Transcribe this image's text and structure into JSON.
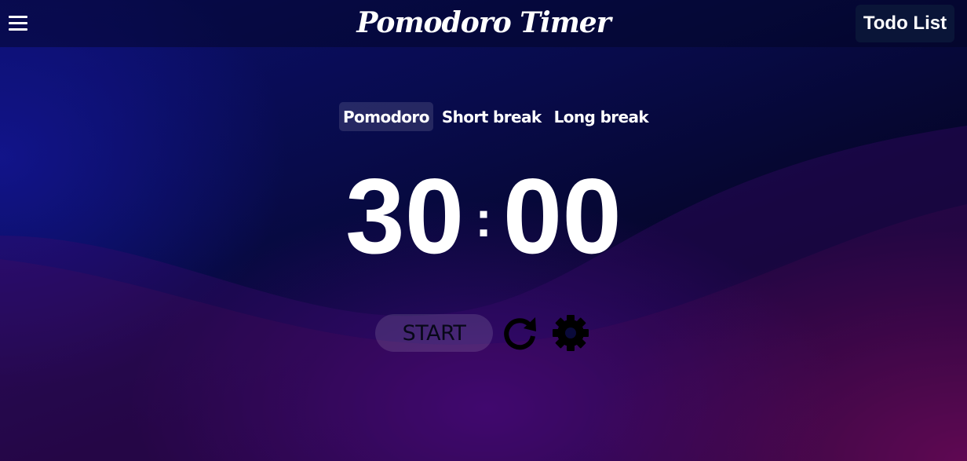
{
  "header": {
    "menu_icon": "hamburger-menu-icon",
    "title": "Pomodoro Timer",
    "todo_label": "Todo List"
  },
  "modes": [
    {
      "label": "Pomodoro",
      "active": true
    },
    {
      "label": "Short break",
      "active": false
    },
    {
      "label": "Long break",
      "active": false
    }
  ],
  "timer": {
    "minutes": "30",
    "separator": ":",
    "seconds": "00"
  },
  "controls": {
    "start_label": "START",
    "reset_icon": "reset-icon",
    "settings_icon": "gear-icon"
  },
  "colors": {
    "text": "#ffffff",
    "start_text": "#070818",
    "todo_bg": "#0a1538"
  }
}
